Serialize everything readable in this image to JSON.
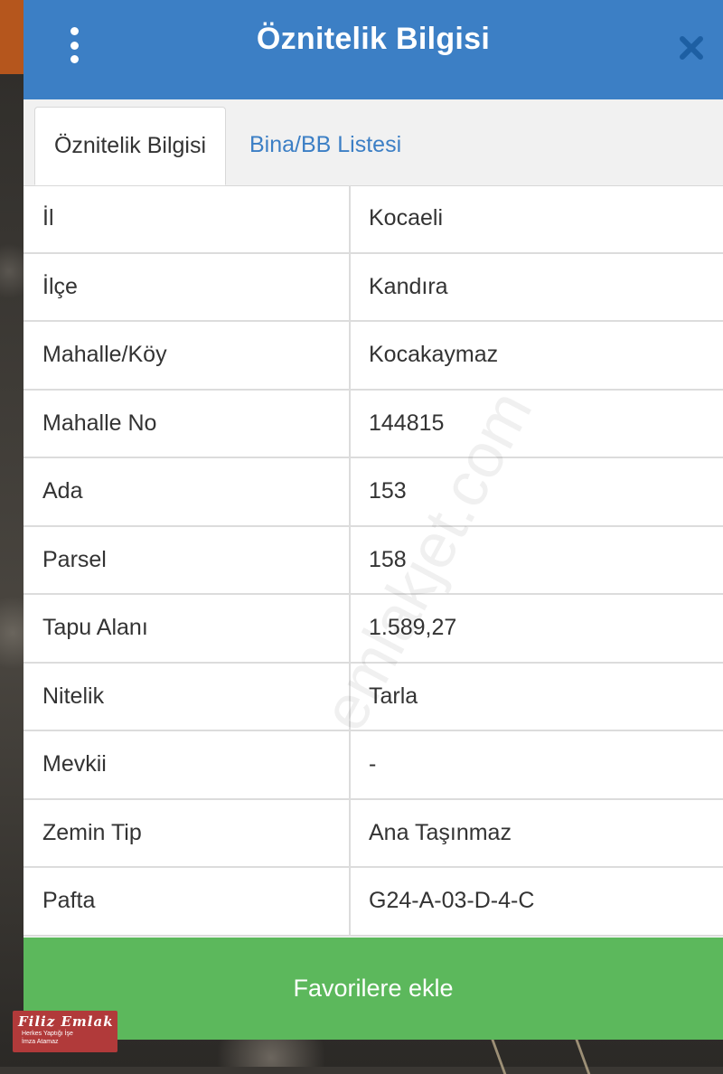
{
  "header": {
    "title": "Öznitelik Bilgisi",
    "menu_icon": "more-vertical-icon",
    "close_icon": "close-icon"
  },
  "tabs": [
    {
      "label": "Öznitelik Bilgisi",
      "active": true
    },
    {
      "label": "Bina/BB Listesi",
      "active": false
    }
  ],
  "rows": [
    {
      "key": "İl",
      "value": "Kocaeli"
    },
    {
      "key": "İlçe",
      "value": "Kandıra"
    },
    {
      "key": "Mahalle/Köy",
      "value": "Kocakaymaz"
    },
    {
      "key": "Mahalle No",
      "value": "144815"
    },
    {
      "key": "Ada",
      "value": "153"
    },
    {
      "key": "Parsel",
      "value": "158"
    },
    {
      "key": "Tapu Alanı",
      "value": "1.589,27"
    },
    {
      "key": "Nitelik",
      "value": "Tarla"
    },
    {
      "key": "Mevkii",
      "value": "-"
    },
    {
      "key": "Zemin Tip",
      "value": "Ana Taşınmaz"
    },
    {
      "key": "Pafta",
      "value": "G24-A-03-D-4-C"
    }
  ],
  "actions": {
    "favorite_label": "Favorilere ekle"
  },
  "watermark": "emlakjet.com",
  "logo": {
    "line1": "Filiz Emlak",
    "line2": "Herkes Yaptığı İşe",
    "line3": "İmza Atamaz"
  },
  "colors": {
    "header": "#3c7fc5",
    "tab_link": "#3c7fc5",
    "favorite_button": "#5cb85c"
  }
}
